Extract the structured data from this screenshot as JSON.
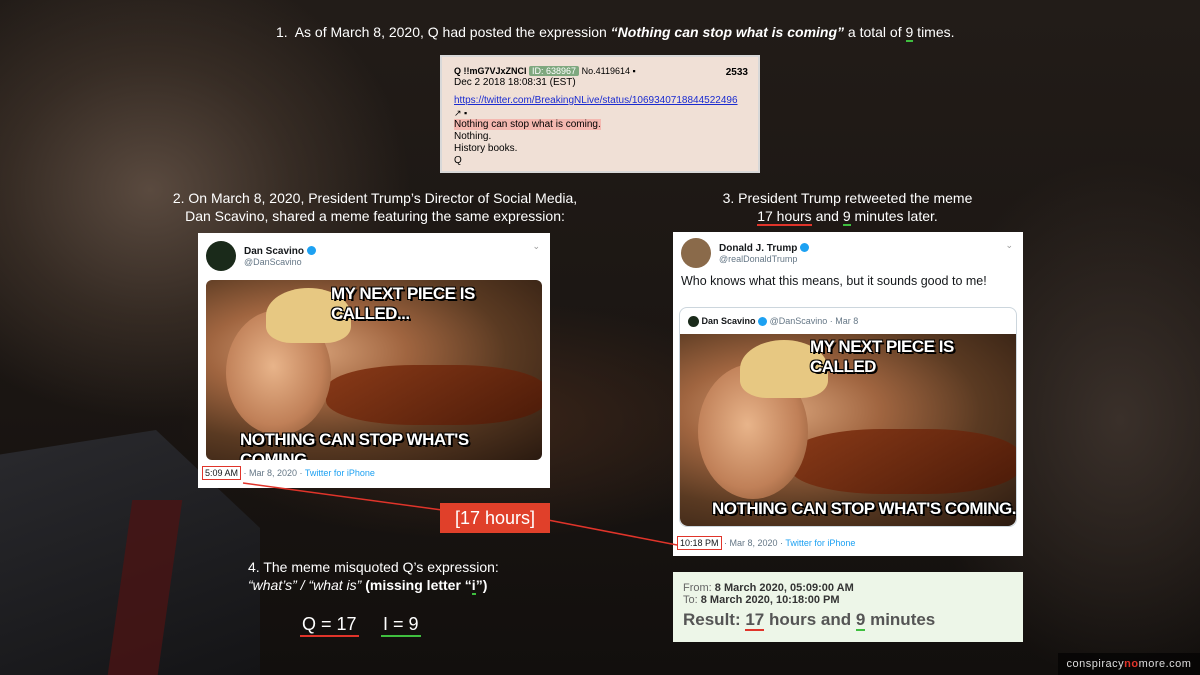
{
  "caption1": {
    "number": "1.",
    "pre": "As of March 8, 2020, Q had posted the expression ",
    "quote": "“Nothing can stop what is coming”",
    "mid": " a total of ",
    "count": "9",
    "post": " times."
  },
  "qpost": {
    "header_name": "Q !!mG7VJxZNCI",
    "id_badge": "ID: 638967",
    "no": "No.4119614",
    "post_number": "2533",
    "date": "Dec 2 2018 18:08:31 (EST)",
    "link": "https://twitter.com/BreakingNLive/status/1069340718844522496",
    "line1": "Nothing can stop what is coming.",
    "line2": "Nothing.",
    "line3": "History books.",
    "line4": "Q"
  },
  "caption2": {
    "line1": "2. On March 8, 2020, President Trump’s Director of Social Media,",
    "line2": "Dan Scavino, shared a meme featuring the same expression:"
  },
  "caption3": {
    "line1": "3. President Trump retweeted the meme",
    "hours": "17 hours",
    "and": " and ",
    "minutes": "9",
    "rest": " minutes later."
  },
  "tweet_scavino": {
    "name": "Dan Scavino",
    "handle": "@DanScavino",
    "meme_top": "MY NEXT PIECE IS CALLED...",
    "meme_bottom": "NOTHING CAN STOP WHAT'S COMING.",
    "time": "5:09 AM",
    "date": " · Mar 8, 2020 · ",
    "source": "Twitter for iPhone"
  },
  "tweet_trump": {
    "name": "Donald J. Trump",
    "handle": "@realDonaldTrump",
    "text": "Who knows what this means, but it sounds good to me!",
    "quoted_name": "Dan Scavino",
    "quoted_handle": "@DanScavino · Mar 8",
    "meme_top": "MY NEXT PIECE IS CALLED",
    "meme_bottom": "NOTHING CAN STOP WHAT'S COMING.",
    "time": "10:18 PM",
    "date": " · Mar 8, 2020 · ",
    "source": "Twitter for iPhone"
  },
  "hours_label": "[17 hours]",
  "caption4": {
    "line1": "4. The meme misquoted Q’s expression:",
    "italic": "“what’s” / “what is”",
    "bold_pre": " (missing letter “",
    "letter": "i",
    "bold_post": "”)"
  },
  "equations": {
    "q": "Q = 17",
    "i": "I = 9"
  },
  "result": {
    "from_label": "From: ",
    "from_value": "8 March 2020, 05:09:00 AM",
    "to_label": "To: ",
    "to_value": "8 March 2020, 10:18:00 PM",
    "result_label": "Result: ",
    "hours": "17",
    "mid": " hours and ",
    "minutes": "9",
    "end": " minutes"
  },
  "watermark": {
    "pre": "conspiracy",
    "mid": "no",
    "post": "more.com"
  },
  "colors": {
    "red": "#e0342a",
    "green": "#3fbf3f",
    "accent_box": "#e0402a"
  }
}
